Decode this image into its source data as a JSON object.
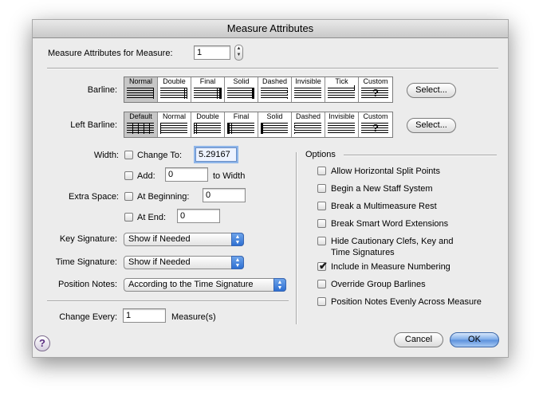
{
  "window": {
    "title": "Measure Attributes"
  },
  "measure": {
    "label": "Measure Attributes for Measure:",
    "value": "1"
  },
  "barline": {
    "label": "Barline:",
    "options": [
      "Normal",
      "Double",
      "Final",
      "Solid",
      "Dashed",
      "Invisible",
      "Tick",
      "Custom"
    ],
    "selected": "Normal",
    "select_button": "Select..."
  },
  "left_barline": {
    "label": "Left Barline:",
    "options": [
      "Default",
      "Normal",
      "Double",
      "Final",
      "Solid",
      "Dashed",
      "Invisible",
      "Custom"
    ],
    "selected": "Default",
    "select_button": "Select..."
  },
  "width": {
    "label": "Width:",
    "change_to_label": "Change To:",
    "change_to_value": "5.29167",
    "add_label": "Add:",
    "add_value": "0",
    "to_width_label": "to Width"
  },
  "extra_space": {
    "label": "Extra Space:",
    "at_beginning_label": "At Beginning:",
    "at_beginning_value": "0",
    "at_end_label": "At End:",
    "at_end_value": "0"
  },
  "key_signature": {
    "label": "Key Signature:",
    "value": "Show if Needed"
  },
  "time_signature": {
    "label": "Time Signature:",
    "value": "Show if Needed"
  },
  "position_notes": {
    "label": "Position Notes:",
    "value": "According to the Time Signature"
  },
  "change_every": {
    "label": "Change Every:",
    "value": "1",
    "unit": "Measure(s)"
  },
  "options": {
    "title": "Options",
    "items": [
      {
        "label": "Allow Horizontal Split Points",
        "checked": false
      },
      {
        "label": "Begin a New Staff System",
        "checked": false
      },
      {
        "label": "Break a Multimeasure Rest",
        "checked": false
      },
      {
        "label": "Break Smart Word Extensions",
        "checked": false
      },
      {
        "label": "Hide Cautionary Clefs, Key and",
        "label2": "Time Signatures",
        "checked": false
      },
      {
        "label": "Include in Measure Numbering",
        "checked": true
      },
      {
        "label": "Override Group Barlines",
        "checked": false
      },
      {
        "label": "Position Notes Evenly Across Measure",
        "checked": false
      }
    ]
  },
  "buttons": {
    "cancel": "Cancel",
    "ok": "OK",
    "help": "?"
  },
  "glyphs": {
    "check": "✔",
    "up": "▲",
    "down": "▼",
    "custom_mark": "?"
  },
  "colors": {
    "accent": "#5a90dc",
    "focus": "#8fb6ea"
  }
}
